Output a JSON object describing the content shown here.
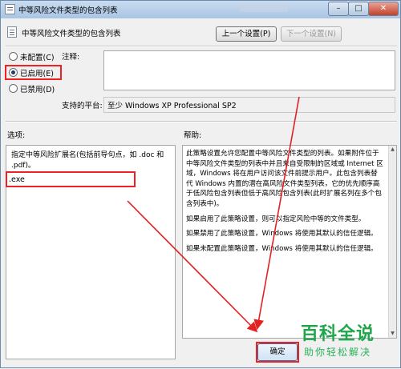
{
  "window": {
    "title": "中等风险文件类型的包含列表",
    "minimize_glyph": "–",
    "maximize_glyph": "□",
    "close_glyph": "✕"
  },
  "header": {
    "title": "中等风险文件类型的包含列表",
    "prev_button": "上一个设置(P)",
    "next_button": "下一个设置(N)"
  },
  "state": {
    "options": [
      {
        "label": "未配置(C)",
        "selected": false
      },
      {
        "label": "已启用(E)",
        "selected": true
      },
      {
        "label": "已禁用(D)",
        "selected": false
      }
    ],
    "comment_label": "注释:",
    "comment_value": "",
    "platform_label": "支持的平台:",
    "platform_value": "至少 Windows XP Professional SP2"
  },
  "options_panel": {
    "heading": "选项:",
    "description": "指定中等风险扩展名(包括前导句点，如 .doc 和 .pdf)。",
    "extension_value": ".exe"
  },
  "help_panel": {
    "heading": "帮助:",
    "paragraphs": [
      "此策略设置允许您配置中等风险文件类型的列表。如果附件位于中等风险文件类型的列表中并且来自受限制的区域或 Internet 区域，Windows 将在用户访问该文件前提示用户。此包含列表替代 Windows 内置的潜在高风险文件类型列表，它的优先顺序高于低风险包含列表但低于高风险包含列表(此时扩展名列在多个包含列表中)。",
      "如果启用了此策略设置，则可以指定风险中等的文件类型。",
      "如果禁用了此策略设置，Windows 将使用其默认的信任逻辑。",
      "如果未配置此策略设置，Windows 将使用其默认的信任逻辑。"
    ]
  },
  "footer": {
    "ok_button": "确定"
  },
  "watermark": {
    "big": "百科全说",
    "small": "助你轻松解决"
  },
  "colors": {
    "highlight_red": "#e22222",
    "watermark_green": "#1fa64a"
  }
}
